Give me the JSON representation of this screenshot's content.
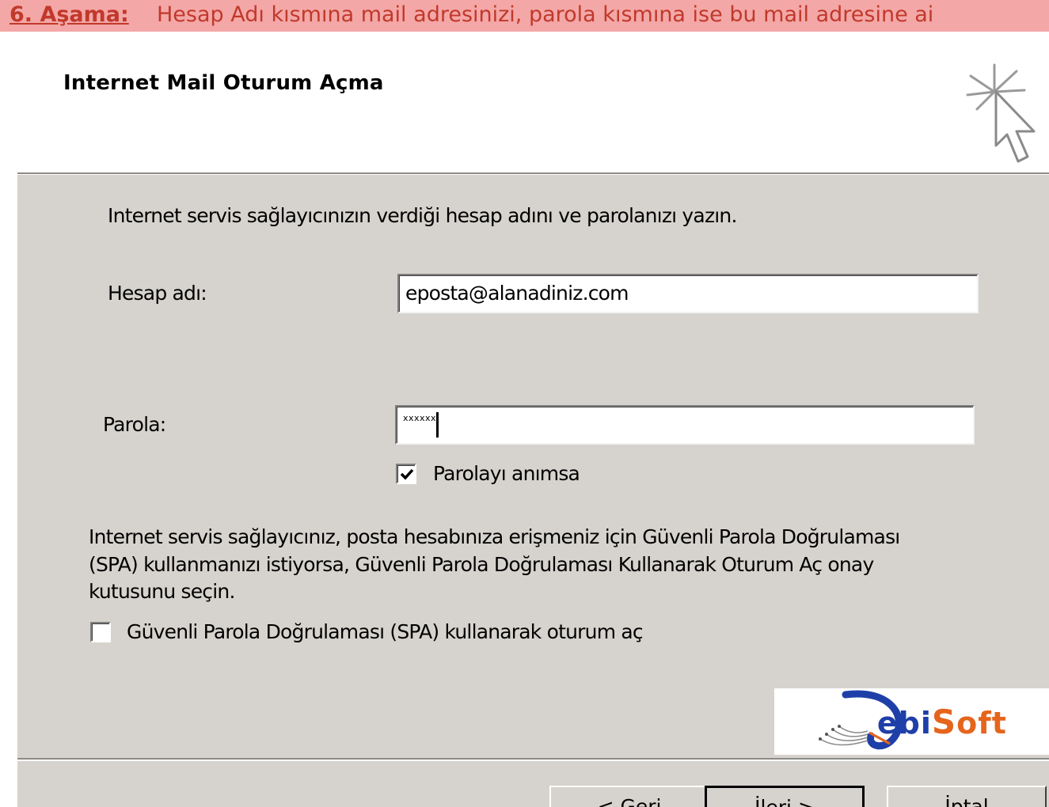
{
  "banner": {
    "step_label": "6. Aşama:",
    "text": "Hesap Adı kısmına mail adresinizi, parola kısmına ise bu mail adresine ai"
  },
  "header": {
    "title": "Internet Mail Oturum Açma",
    "icon": "wizard-cursor-icon"
  },
  "form": {
    "intro": "Internet servis sağlayıcınızın verdiği hesap adını ve parolanızı yazın.",
    "account_label": "Hesap adı:",
    "account_value": "eposta@alanadiniz.com",
    "password_label": "Parola:",
    "password_value": "xxxxxx",
    "remember_label": "Parolayı anımsa",
    "remember_checked": true,
    "spa_info_line1": "Internet servis sağlayıcınız, posta hesabınıza erişmeniz için Güvenli Parola Doğrulaması",
    "spa_info_line2": "(SPA) kullanmanızı istiyorsa, Güvenli Parola Doğrulaması Kullanarak Oturum Aç onay",
    "spa_info_line3": "kutusunu seçin.",
    "spa_label": "Güvenli Parola Doğrulaması (SPA) kullanarak oturum aç",
    "spa_checked": false
  },
  "logo": {
    "text_d": "D",
    "text_ebi": "ebi",
    "text_s": "S",
    "text_oft": "oft"
  },
  "buttons": {
    "back": "< Geri",
    "next": "İleri >",
    "cancel": "İptal"
  },
  "colors": {
    "banner_bg": "#f4a7a7",
    "banner_text": "#c0392b",
    "dialog_bg": "#d6d3ce",
    "logo_blue": "#1f3fa8",
    "logo_orange": "#e5651d"
  }
}
